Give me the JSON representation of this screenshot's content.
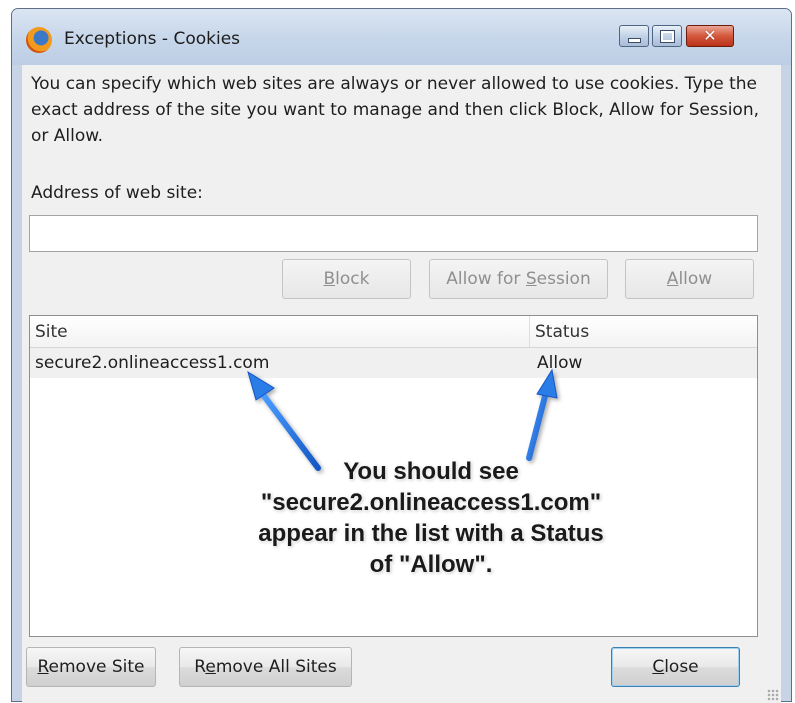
{
  "window": {
    "title": "Exceptions - Cookies"
  },
  "dialog": {
    "intro_text": "You can specify which web sites are always or never allowed to use cookies. Type the exact address of the site you want to manage and then click Block, Allow for Session, or Allow.",
    "address_label": "Address of web site:",
    "address_value": ""
  },
  "buttons": {
    "block": {
      "prefix": "",
      "key": "B",
      "suffix": "lock"
    },
    "allow_for_session": {
      "prefix": "Allow for ",
      "key": "S",
      "suffix": "ession"
    },
    "allow": {
      "prefix": "",
      "key": "A",
      "suffix": "llow"
    },
    "remove_site": {
      "prefix": "",
      "key": "R",
      "suffix": "emove Site"
    },
    "remove_all_sites": {
      "prefix": "R",
      "key": "e",
      "suffix": "move All Sites"
    },
    "close": {
      "prefix": "",
      "key": "C",
      "suffix": "lose"
    }
  },
  "site_list": {
    "columns": [
      "Site",
      "Status"
    ],
    "rows": [
      {
        "site": "secure2.onlineaccess1.com",
        "status": "Allow"
      }
    ]
  },
  "annotation": {
    "lines": [
      "You should see",
      "\"secure2.onlineaccess1.com\"",
      "appear in the list with a Status",
      "of \"Allow\"."
    ],
    "arrow_color": "#1e6fe0"
  },
  "icons": {
    "app": "firefox-icon",
    "minimize": "minimize-icon",
    "maximize": "maximize-icon",
    "close": "close-icon",
    "resize": "resize-grip-icon"
  },
  "colors": {
    "title_bar": "#c9d8eb",
    "close_button": "#d4583c",
    "dialog_background": "#f0f0f0",
    "annotation_arrow": "#1e6fe0"
  }
}
